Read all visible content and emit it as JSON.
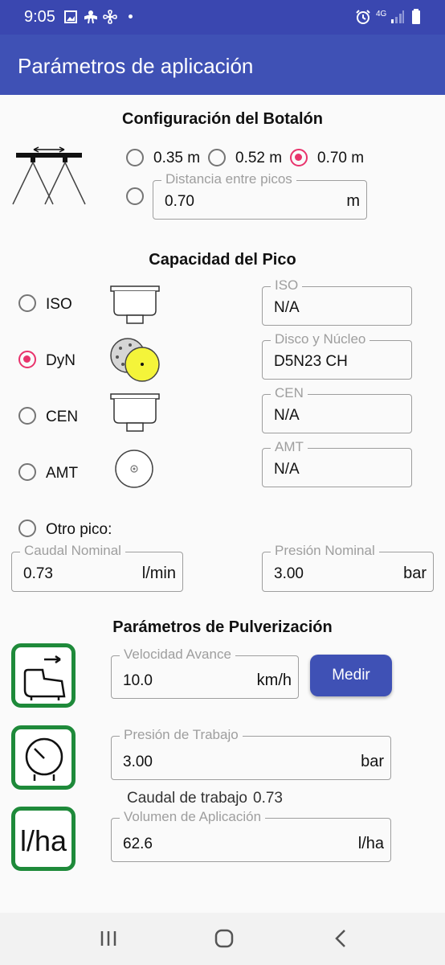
{
  "status": {
    "time": "9:05",
    "network": "4G"
  },
  "app": {
    "title": "Parámetros de aplicación"
  },
  "boom": {
    "title": "Configuración del Botalón",
    "options": [
      "0.35 m",
      "0.52 m",
      "0.70 m"
    ],
    "selected": "0.70 m",
    "distance": {
      "label": "Distancia entre picos",
      "value": "0.70",
      "unit": "m"
    }
  },
  "nozzle": {
    "title": "Capacidad del Pico",
    "options": [
      {
        "label": "ISO",
        "field_label": "ISO",
        "value": "N/A"
      },
      {
        "label": "DyN",
        "field_label": "Disco y Núcleo",
        "value": "D5N23 CH"
      },
      {
        "label": "CEN",
        "field_label": "CEN",
        "value": "N/A"
      },
      {
        "label": "AMT",
        "field_label": "AMT",
        "value": "N/A"
      }
    ],
    "selected": "DyN",
    "other_label": "Otro pico:",
    "flow": {
      "label": "Caudal Nominal",
      "value": "0.73",
      "unit": "l/min"
    },
    "pressure": {
      "label": "Presión Nominal",
      "value": "3.00",
      "unit": "bar"
    }
  },
  "spray": {
    "title": "Parámetros de Pulverización",
    "speed": {
      "label": "Velocidad Avance",
      "value": "10.0",
      "unit": "km/h"
    },
    "measure_label": "Medir",
    "pressure": {
      "label": "Presión de Trabajo",
      "value": "3.00",
      "unit": "bar"
    },
    "work_flow_label": "Caudal de trabajo",
    "work_flow_value": "0.73",
    "volume": {
      "label": "Volumen de Aplicación",
      "value": "62.6",
      "unit": "l/ha"
    },
    "volume_icon_text": "l/ha"
  },
  "icons": {
    "status": [
      "image-icon",
      "accessibility-icon",
      "fan-icon",
      "alarm-icon",
      "signal-icon",
      "battery-icon"
    ]
  }
}
